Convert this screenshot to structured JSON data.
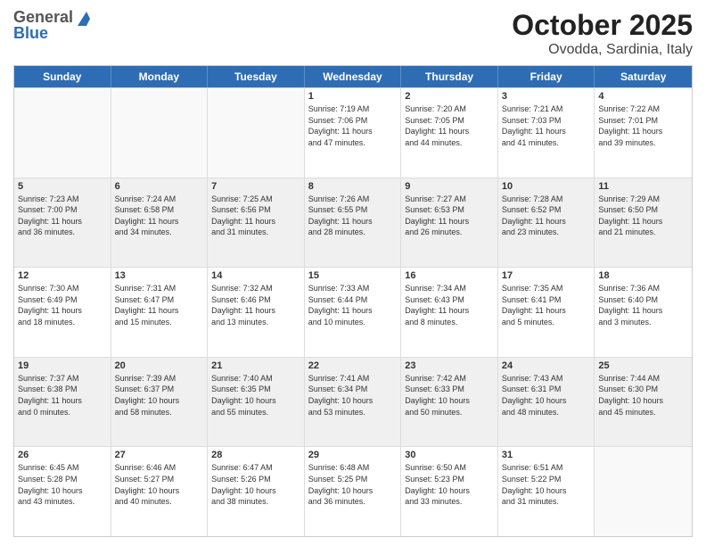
{
  "header": {
    "logo_general": "General",
    "logo_blue": "Blue",
    "title": "October 2025",
    "subtitle": "Ovodda, Sardinia, Italy"
  },
  "days_of_week": [
    "Sunday",
    "Monday",
    "Tuesday",
    "Wednesday",
    "Thursday",
    "Friday",
    "Saturday"
  ],
  "weeks": [
    [
      {
        "day": "",
        "info": ""
      },
      {
        "day": "",
        "info": ""
      },
      {
        "day": "",
        "info": ""
      },
      {
        "day": "1",
        "info": "Sunrise: 7:19 AM\nSunset: 7:06 PM\nDaylight: 11 hours\nand 47 minutes."
      },
      {
        "day": "2",
        "info": "Sunrise: 7:20 AM\nSunset: 7:05 PM\nDaylight: 11 hours\nand 44 minutes."
      },
      {
        "day": "3",
        "info": "Sunrise: 7:21 AM\nSunset: 7:03 PM\nDaylight: 11 hours\nand 41 minutes."
      },
      {
        "day": "4",
        "info": "Sunrise: 7:22 AM\nSunset: 7:01 PM\nDaylight: 11 hours\nand 39 minutes."
      }
    ],
    [
      {
        "day": "5",
        "info": "Sunrise: 7:23 AM\nSunset: 7:00 PM\nDaylight: 11 hours\nand 36 minutes."
      },
      {
        "day": "6",
        "info": "Sunrise: 7:24 AM\nSunset: 6:58 PM\nDaylight: 11 hours\nand 34 minutes."
      },
      {
        "day": "7",
        "info": "Sunrise: 7:25 AM\nSunset: 6:56 PM\nDaylight: 11 hours\nand 31 minutes."
      },
      {
        "day": "8",
        "info": "Sunrise: 7:26 AM\nSunset: 6:55 PM\nDaylight: 11 hours\nand 28 minutes."
      },
      {
        "day": "9",
        "info": "Sunrise: 7:27 AM\nSunset: 6:53 PM\nDaylight: 11 hours\nand 26 minutes."
      },
      {
        "day": "10",
        "info": "Sunrise: 7:28 AM\nSunset: 6:52 PM\nDaylight: 11 hours\nand 23 minutes."
      },
      {
        "day": "11",
        "info": "Sunrise: 7:29 AM\nSunset: 6:50 PM\nDaylight: 11 hours\nand 21 minutes."
      }
    ],
    [
      {
        "day": "12",
        "info": "Sunrise: 7:30 AM\nSunset: 6:49 PM\nDaylight: 11 hours\nand 18 minutes."
      },
      {
        "day": "13",
        "info": "Sunrise: 7:31 AM\nSunset: 6:47 PM\nDaylight: 11 hours\nand 15 minutes."
      },
      {
        "day": "14",
        "info": "Sunrise: 7:32 AM\nSunset: 6:46 PM\nDaylight: 11 hours\nand 13 minutes."
      },
      {
        "day": "15",
        "info": "Sunrise: 7:33 AM\nSunset: 6:44 PM\nDaylight: 11 hours\nand 10 minutes."
      },
      {
        "day": "16",
        "info": "Sunrise: 7:34 AM\nSunset: 6:43 PM\nDaylight: 11 hours\nand 8 minutes."
      },
      {
        "day": "17",
        "info": "Sunrise: 7:35 AM\nSunset: 6:41 PM\nDaylight: 11 hours\nand 5 minutes."
      },
      {
        "day": "18",
        "info": "Sunrise: 7:36 AM\nSunset: 6:40 PM\nDaylight: 11 hours\nand 3 minutes."
      }
    ],
    [
      {
        "day": "19",
        "info": "Sunrise: 7:37 AM\nSunset: 6:38 PM\nDaylight: 11 hours\nand 0 minutes."
      },
      {
        "day": "20",
        "info": "Sunrise: 7:39 AM\nSunset: 6:37 PM\nDaylight: 10 hours\nand 58 minutes."
      },
      {
        "day": "21",
        "info": "Sunrise: 7:40 AM\nSunset: 6:35 PM\nDaylight: 10 hours\nand 55 minutes."
      },
      {
        "day": "22",
        "info": "Sunrise: 7:41 AM\nSunset: 6:34 PM\nDaylight: 10 hours\nand 53 minutes."
      },
      {
        "day": "23",
        "info": "Sunrise: 7:42 AM\nSunset: 6:33 PM\nDaylight: 10 hours\nand 50 minutes."
      },
      {
        "day": "24",
        "info": "Sunrise: 7:43 AM\nSunset: 6:31 PM\nDaylight: 10 hours\nand 48 minutes."
      },
      {
        "day": "25",
        "info": "Sunrise: 7:44 AM\nSunset: 6:30 PM\nDaylight: 10 hours\nand 45 minutes."
      }
    ],
    [
      {
        "day": "26",
        "info": "Sunrise: 6:45 AM\nSunset: 5:28 PM\nDaylight: 10 hours\nand 43 minutes."
      },
      {
        "day": "27",
        "info": "Sunrise: 6:46 AM\nSunset: 5:27 PM\nDaylight: 10 hours\nand 40 minutes."
      },
      {
        "day": "28",
        "info": "Sunrise: 6:47 AM\nSunset: 5:26 PM\nDaylight: 10 hours\nand 38 minutes."
      },
      {
        "day": "29",
        "info": "Sunrise: 6:48 AM\nSunset: 5:25 PM\nDaylight: 10 hours\nand 36 minutes."
      },
      {
        "day": "30",
        "info": "Sunrise: 6:50 AM\nSunset: 5:23 PM\nDaylight: 10 hours\nand 33 minutes."
      },
      {
        "day": "31",
        "info": "Sunrise: 6:51 AM\nSunset: 5:22 PM\nDaylight: 10 hours\nand 31 minutes."
      },
      {
        "day": "",
        "info": ""
      }
    ]
  ]
}
